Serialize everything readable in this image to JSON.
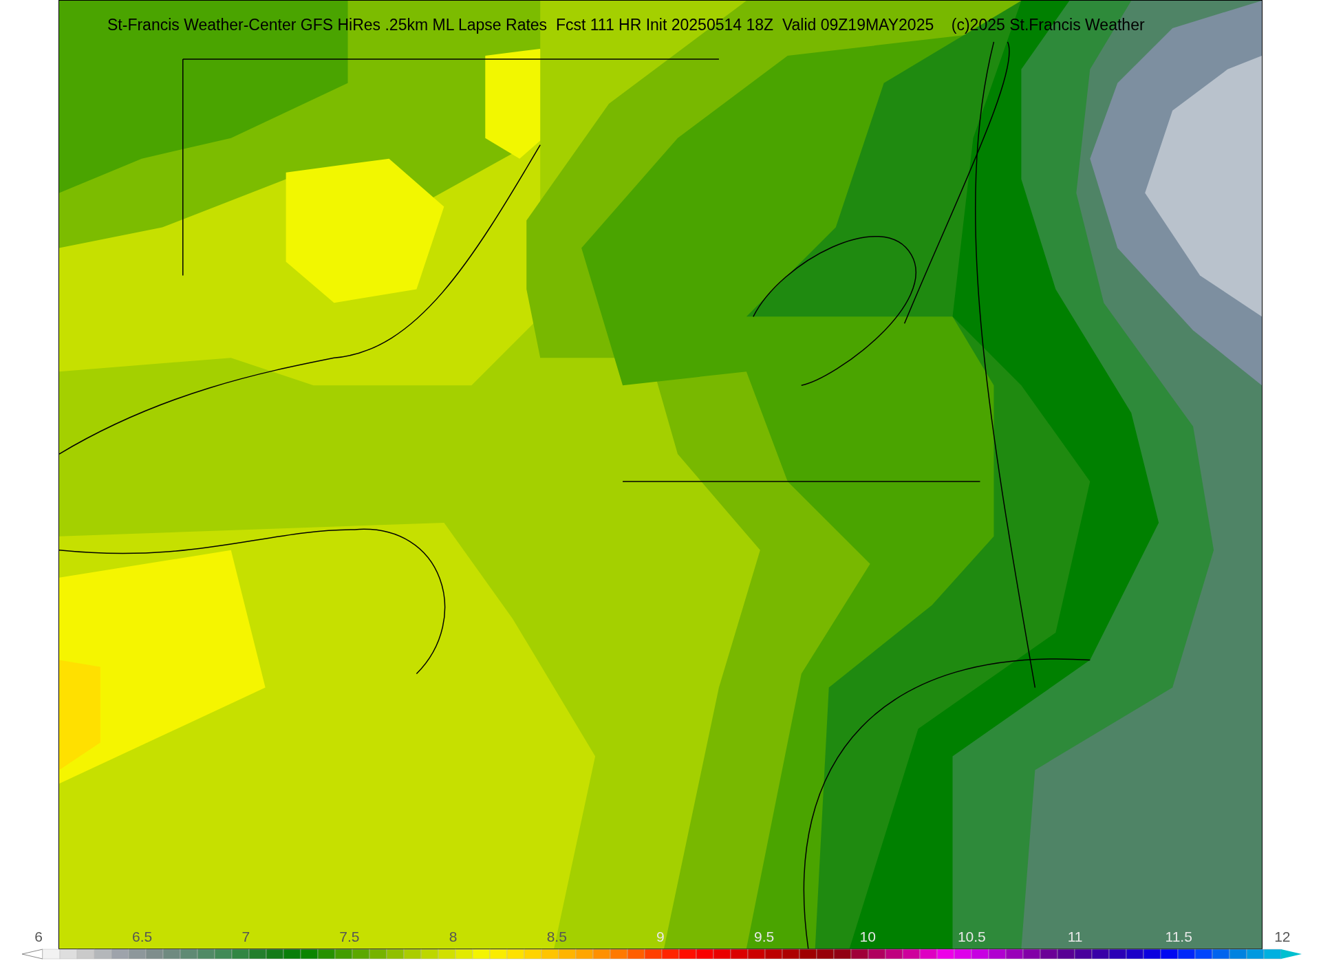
{
  "map": {
    "title": "St-Francis Weather-Center GFS HiRes .25km ML Lapse Rates  Fcst 111 HR Init 20250514 18Z  Valid 09Z19MAY2025    (c)2025 St.Francis Weather"
  },
  "colorbar": {
    "ticks": [
      "6",
      "6.5",
      "7",
      "7.5",
      "8",
      "8.5",
      "9",
      "9.5",
      "10",
      "10.5",
      "11",
      "11.5",
      "12"
    ]
  }
}
